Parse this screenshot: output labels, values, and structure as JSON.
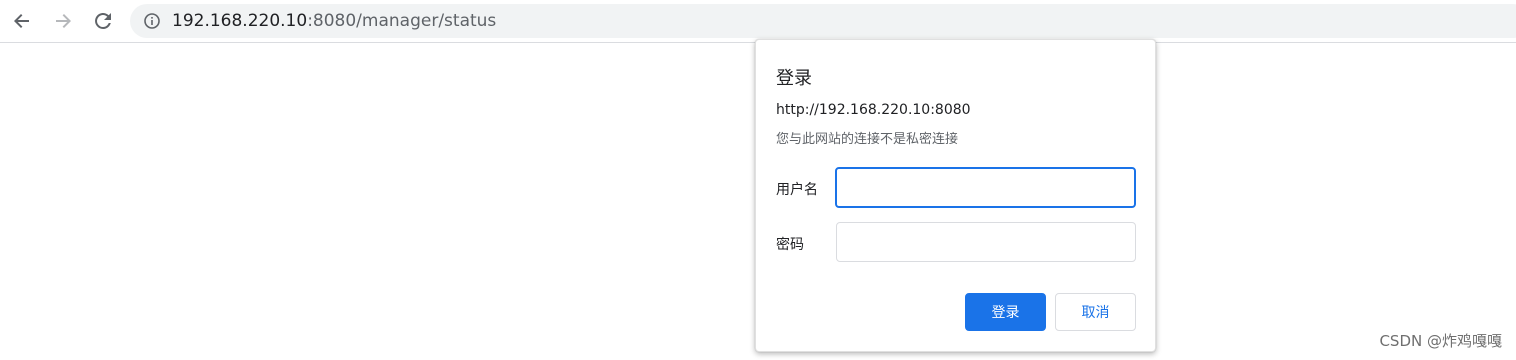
{
  "browser": {
    "url_host": "192.168.220.10",
    "url_rest": ":8080/manager/status",
    "icons": {
      "back": "arrow-left-icon",
      "forward": "arrow-right-icon",
      "reload": "reload-icon",
      "site_info": "info-icon"
    }
  },
  "dialog": {
    "title": "登录",
    "origin": "http://192.168.220.10:8080",
    "warning": "您与此网站的连接不是私密连接",
    "username_label": "用户名",
    "username_value": "",
    "password_label": "密码",
    "password_value": "",
    "login_button": "登录",
    "cancel_button": "取消"
  },
  "watermark": "CSDN @炸鸡嘎嘎",
  "colors": {
    "accent": "#1a73e8",
    "omnibox_bg": "#f1f3f4"
  }
}
